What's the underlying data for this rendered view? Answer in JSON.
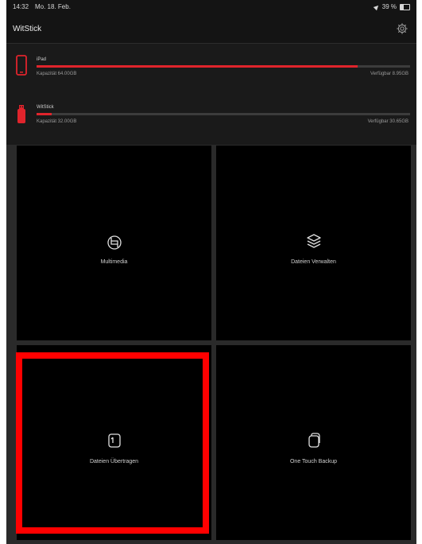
{
  "status_bar": {
    "time": "14:32",
    "date": "Mo. 18. Feb.",
    "battery": "39 %"
  },
  "nav": {
    "title": "WitStick"
  },
  "devices": [
    {
      "name": "iPad",
      "capacity": "Kapazität 64.00GB",
      "available": "Verfügbar 8.95GB",
      "used_fraction": 0.86,
      "icon": "ipad-icon"
    },
    {
      "name": "WitStick",
      "capacity": "Kapazität 32.00GB",
      "available": "Verfügbar 30.65GB",
      "used_fraction": 0.04,
      "icon": "usb-stick-icon"
    }
  ],
  "tiles": [
    {
      "label": "Multimedia",
      "icon": "multimedia-icon"
    },
    {
      "label": "Dateien Verwalten",
      "icon": "layers-icon"
    },
    {
      "label": "Dateien Übertragen",
      "icon": "transfer-icon"
    },
    {
      "label": "One Touch Backup",
      "icon": "backup-icon"
    }
  ],
  "colors": {
    "accent": "#e0242c",
    "highlight": "#ff0000",
    "tile_bg": "#000000",
    "panel_bg": "#1a1a1a"
  }
}
